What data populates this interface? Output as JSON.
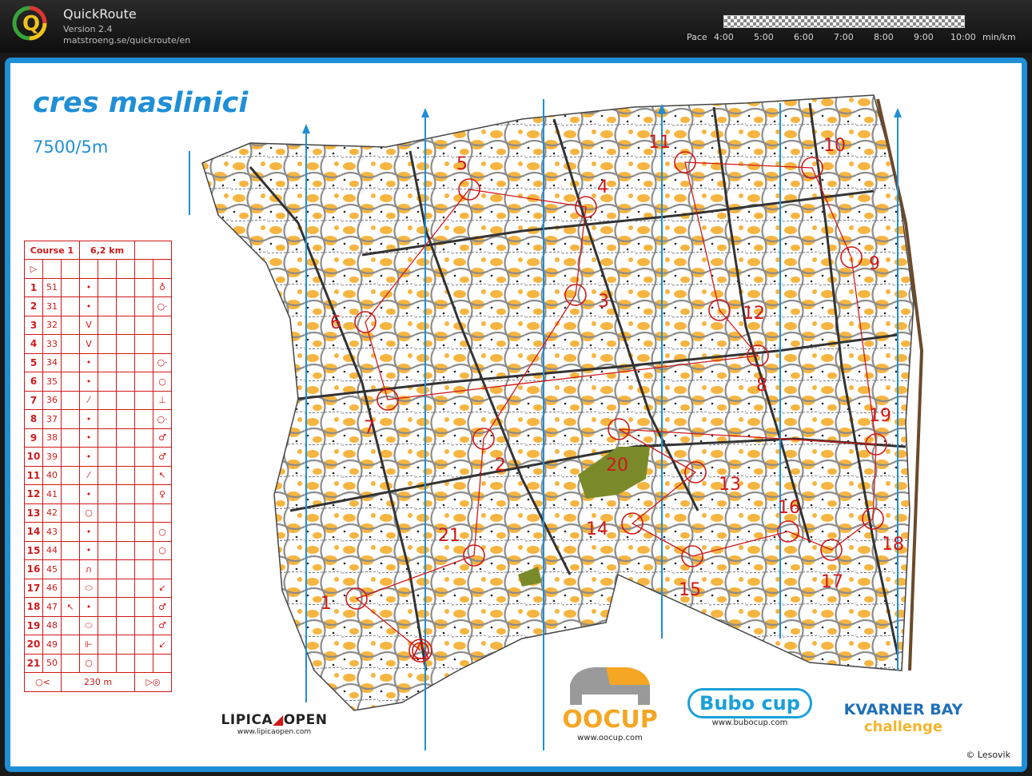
{
  "app": {
    "logo_letter": "Q",
    "name": "QuickRoute",
    "version": "Version 2.4",
    "url": "matstroeng.se/quickroute/en"
  },
  "pace": {
    "label": "Pace",
    "ticks": [
      "4:00",
      "5:00",
      "6:00",
      "7:00",
      "8:00",
      "9:00",
      "10:00"
    ],
    "unit": "min/km"
  },
  "map": {
    "title": "cres maslinici",
    "subtitle": "7500/5m",
    "course_name": "Course 1",
    "course_length": "6,2 km",
    "finish_distance": "230 m",
    "controls": [
      {
        "n": "1",
        "code": "51"
      },
      {
        "n": "2",
        "code": "31"
      },
      {
        "n": "3",
        "code": "32"
      },
      {
        "n": "4",
        "code": "33"
      },
      {
        "n": "5",
        "code": "34"
      },
      {
        "n": "6",
        "code": "35"
      },
      {
        "n": "7",
        "code": "36"
      },
      {
        "n": "8",
        "code": "37"
      },
      {
        "n": "9",
        "code": "38"
      },
      {
        "n": "10",
        "code": "39"
      },
      {
        "n": "11",
        "code": "40"
      },
      {
        "n": "12",
        "code": "41"
      },
      {
        "n": "13",
        "code": "42"
      },
      {
        "n": "14",
        "code": "43"
      },
      {
        "n": "15",
        "code": "44"
      },
      {
        "n": "16",
        "code": "45"
      },
      {
        "n": "17",
        "code": "46"
      },
      {
        "n": "18",
        "code": "47"
      },
      {
        "n": "19",
        "code": "48"
      },
      {
        "n": "20",
        "code": "49"
      },
      {
        "n": "21",
        "code": "50"
      }
    ],
    "symbols": [
      "•",
      "•",
      "V",
      "V",
      "•",
      "•",
      "⁄",
      "•",
      "•",
      "•",
      "⁄",
      "•",
      "○",
      "•",
      "•",
      "∩",
      "⬭",
      "•",
      "⬭",
      "⊩",
      "○"
    ],
    "clues": [
      "♁",
      "○·",
      "",
      "",
      "○·",
      "○",
      "⊥",
      "○·",
      "♂",
      "♂",
      "↖",
      "♀",
      "",
      "○",
      "○",
      "",
      "↙",
      "♂",
      "♂",
      "↙",
      ""
    ],
    "extra": {
      "17": "↖"
    },
    "map_labels": [
      "1",
      "2",
      "3",
      "4",
      "5",
      "6",
      "7",
      "8",
      "9",
      "10",
      "11",
      "12",
      "13",
      "14",
      "15",
      "16",
      "17",
      "18",
      "19",
      "20",
      "21"
    ],
    "colors": {
      "course": "#d01818",
      "north": "#1f8fd6",
      "yellow": "#f6b540",
      "green": "#7a8a2a"
    }
  },
  "sponsors": {
    "lipica": {
      "name_left": "LIPICA",
      "name_right": "OPEN",
      "url": "www.lipicaopen.com"
    },
    "oocup": {
      "name": "OOCUP",
      "url": "www.oocup.com"
    },
    "bubo": {
      "name": "Bubo cup",
      "url": "www.bubocup.com"
    },
    "kvarner": {
      "line1": "KVARNER BAY",
      "line2": "challenge"
    }
  },
  "copyright": "© Lesovik"
}
